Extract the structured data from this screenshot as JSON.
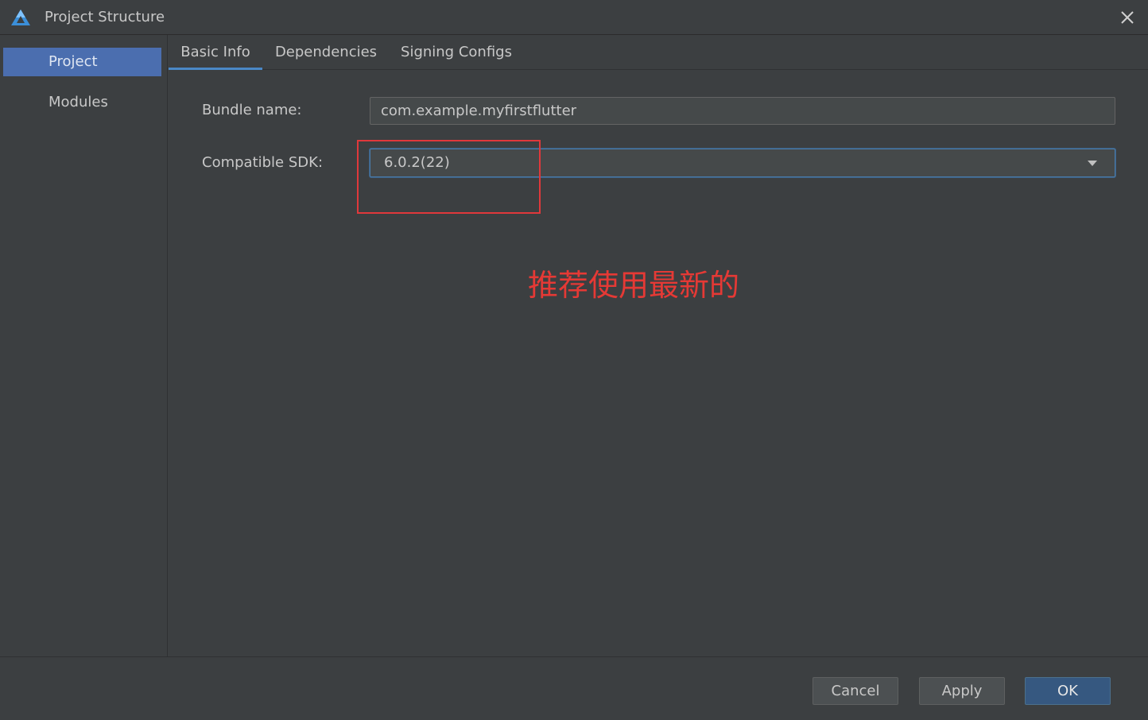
{
  "window": {
    "title": "Project Structure"
  },
  "sidebar": {
    "items": [
      {
        "label": "Project",
        "selected": true
      },
      {
        "label": "Modules",
        "selected": false
      }
    ]
  },
  "tabs": [
    {
      "label": "Basic Info",
      "active": true
    },
    {
      "label": "Dependencies",
      "active": false
    },
    {
      "label": "Signing Configs",
      "active": false
    }
  ],
  "form": {
    "bundle_name_label": "Bundle name:",
    "bundle_name_value": "com.example.myfirstflutter",
    "sdk_label": "Compatible SDK:",
    "sdk_value": "6.0.2(22)"
  },
  "annotation": {
    "text": "推荐使用最新的",
    "color": "#e53935"
  },
  "footer": {
    "cancel_label": "Cancel",
    "apply_label": "Apply",
    "ok_label": "OK"
  },
  "colors": {
    "background": "#3c3f41",
    "selection": "#4b6eaf",
    "tab_underline": "#4a88c7",
    "primary_button": "#365880"
  },
  "icons": {
    "app": "harmony-app-icon",
    "close": "close-icon",
    "dropdown": "chevron-down-icon"
  }
}
